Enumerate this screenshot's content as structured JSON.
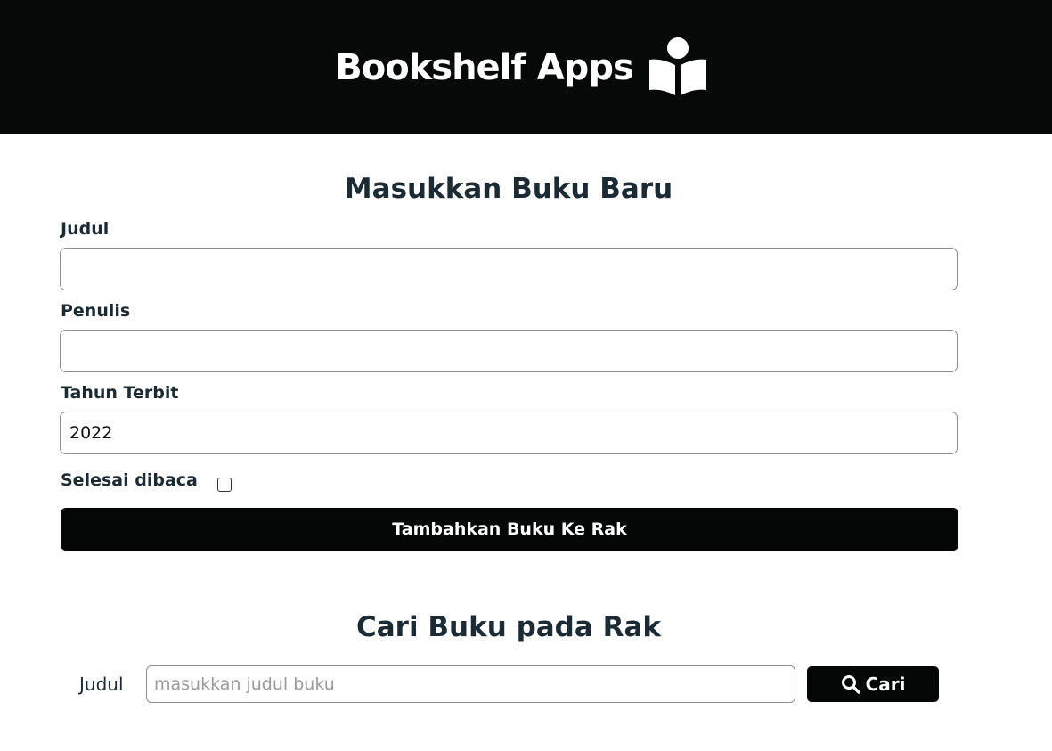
{
  "header": {
    "title": "Bookshelf Apps",
    "icon": "reader-icon"
  },
  "add_form": {
    "heading": "Masukkan Buku Baru",
    "title_label": "Judul",
    "title_value": "",
    "author_label": "Penulis",
    "author_value": "",
    "year_label": "Tahun Terbit",
    "year_value": "2022",
    "complete_label": "Selesai dibaca",
    "complete_checked": false,
    "submit_label": "Tambahkan Buku Ke Rak"
  },
  "search": {
    "heading": "Cari Buku pada Rak",
    "label": "Judul",
    "placeholder": "masukkan judul buku",
    "value": "",
    "button_label": "Cari",
    "button_icon": "search-icon"
  },
  "colors": {
    "header_bg": "#070808",
    "button_bg": "#050606",
    "text": "#1b2a33"
  }
}
